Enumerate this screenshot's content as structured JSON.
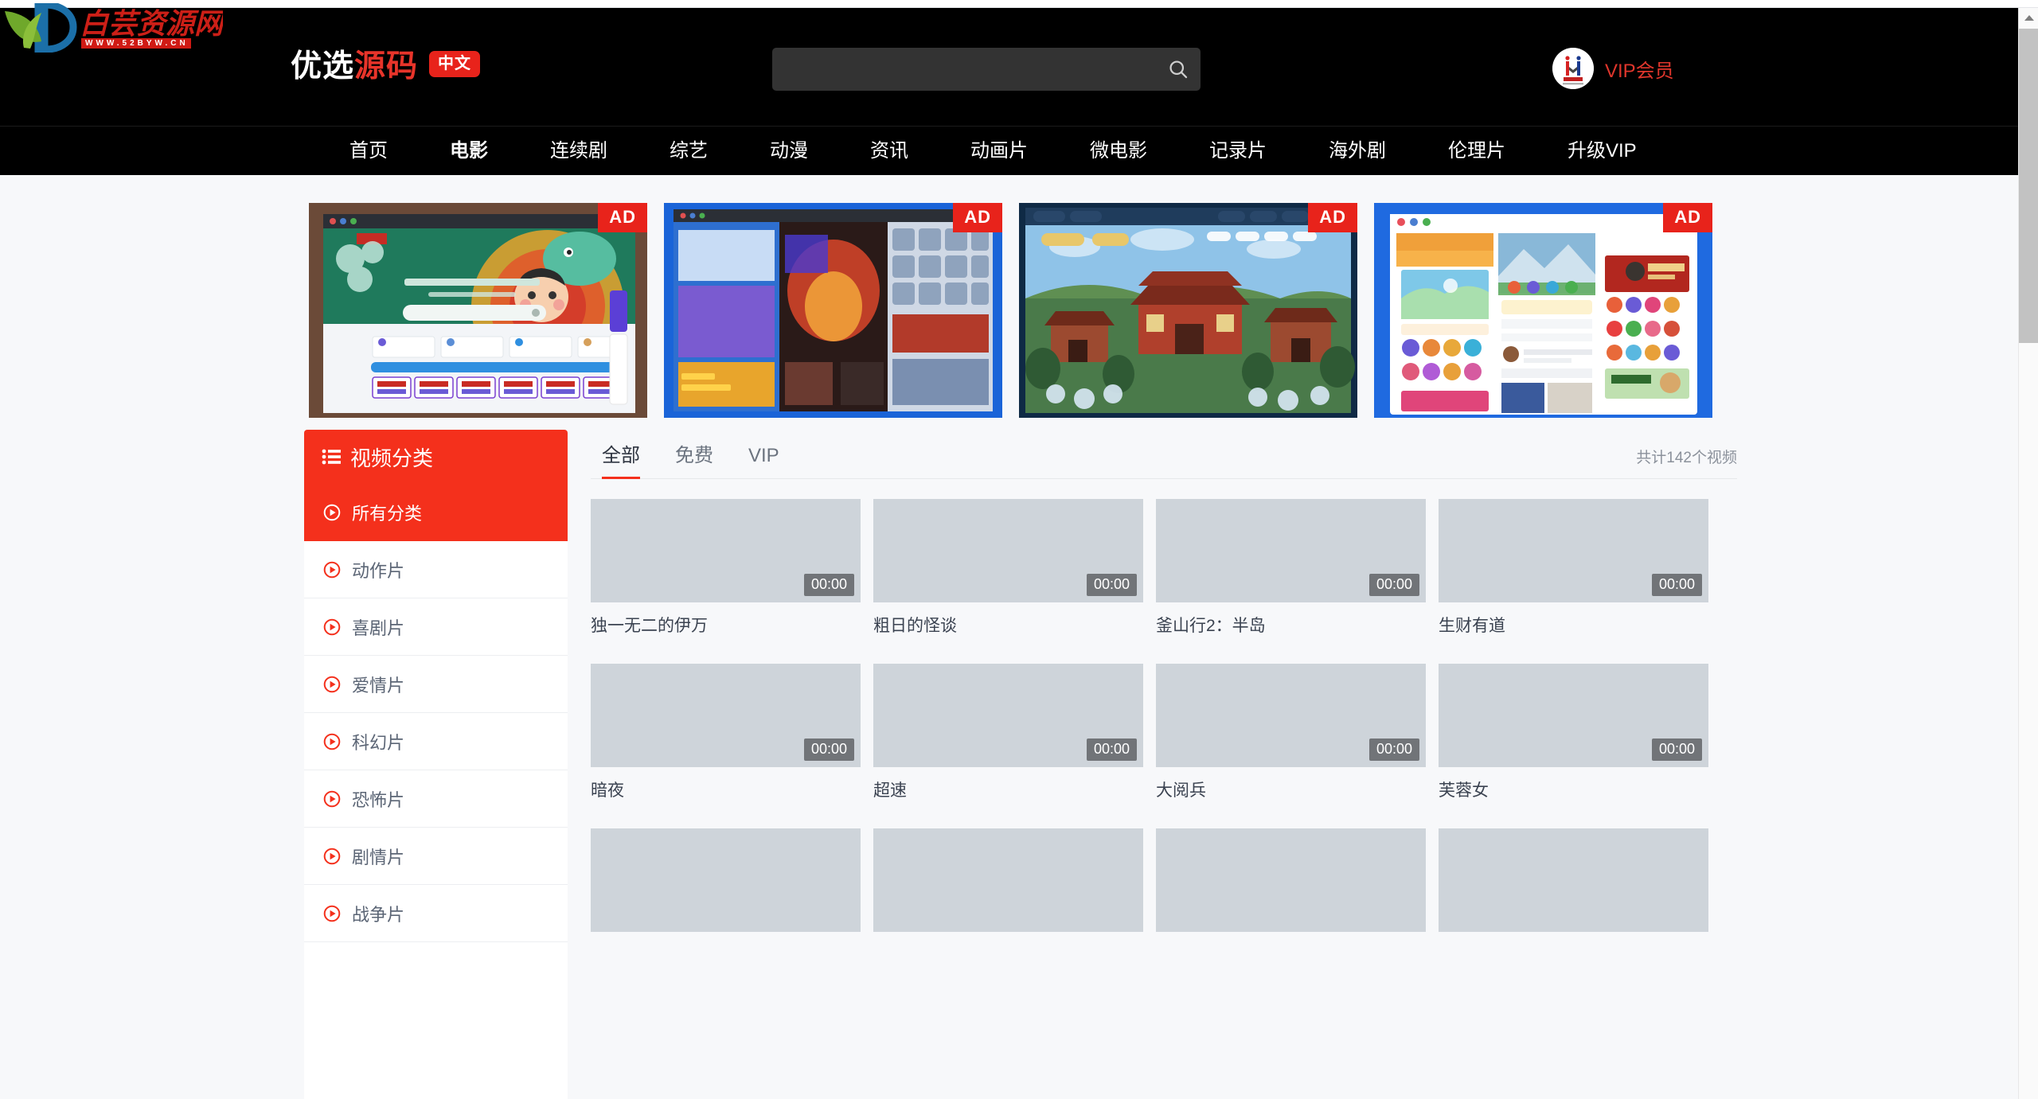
{
  "watermark": {
    "text_cn": "白芸资源网",
    "url": "WWW.52BYW.CN"
  },
  "header": {
    "brand_part1": "优选",
    "brand_part2": "源码",
    "brand_tag": "中文",
    "search": {
      "value": "",
      "placeholder": "",
      "icon": "search-icon"
    },
    "vip": {
      "label": "VIP会员",
      "avatar_icon": "user-avatar-icon"
    }
  },
  "nav": {
    "items": [
      {
        "label": "首页",
        "active": false
      },
      {
        "label": "电影",
        "active": true
      },
      {
        "label": "连续剧",
        "active": false
      },
      {
        "label": "综艺",
        "active": false
      },
      {
        "label": "动漫",
        "active": false
      },
      {
        "label": "资讯",
        "active": false
      },
      {
        "label": "动画片",
        "active": false
      },
      {
        "label": "微电影",
        "active": false
      },
      {
        "label": "记录片",
        "active": false
      },
      {
        "label": "海外剧",
        "active": false
      },
      {
        "label": "伦理片",
        "active": false
      },
      {
        "label": "升级VIP",
        "active": false
      }
    ]
  },
  "ads": {
    "badge_label": "AD",
    "items": [
      {
        "name": "ad-banner-1",
        "theme": "dragon-new-year-site"
      },
      {
        "name": "ad-banner-2",
        "theme": "anime-game-collage"
      },
      {
        "name": "ad-banner-3",
        "theme": "ancient-town-game"
      },
      {
        "name": "ad-banner-4",
        "theme": "mobile-app-screens"
      }
    ]
  },
  "sidebar": {
    "title": "视频分类",
    "title_icon": "list-icon",
    "items": [
      {
        "label": "所有分类",
        "icon": "play-circle-icon",
        "active": true
      },
      {
        "label": "动作片",
        "icon": "play-circle-icon",
        "active": false
      },
      {
        "label": "喜剧片",
        "icon": "play-circle-icon",
        "active": false
      },
      {
        "label": "爱情片",
        "icon": "play-circle-icon",
        "active": false
      },
      {
        "label": "科幻片",
        "icon": "play-circle-icon",
        "active": false
      },
      {
        "label": "恐怖片",
        "icon": "play-circle-icon",
        "active": false
      },
      {
        "label": "剧情片",
        "icon": "play-circle-icon",
        "active": false
      },
      {
        "label": "战争片",
        "icon": "play-circle-icon",
        "active": false
      }
    ]
  },
  "main": {
    "tabs": [
      {
        "label": "全部",
        "active": true
      },
      {
        "label": "免费",
        "active": false
      },
      {
        "label": "VIP",
        "active": false
      }
    ],
    "count_text": "共计142个视频",
    "videos": [
      {
        "title": "独一无二的伊万",
        "duration": "00:00"
      },
      {
        "title": "粗日的怪谈",
        "duration": "00:00"
      },
      {
        "title": "釜山行2：半岛",
        "duration": "00:00"
      },
      {
        "title": "生财有道",
        "duration": "00:00"
      },
      {
        "title": "暗夜",
        "duration": "00:00"
      },
      {
        "title": "超速",
        "duration": "00:00"
      },
      {
        "title": "大阅兵",
        "duration": "00:00"
      },
      {
        "title": "芙蓉女",
        "duration": "00:00"
      },
      {
        "title": "",
        "duration": ""
      },
      {
        "title": "",
        "duration": ""
      },
      {
        "title": "",
        "duration": ""
      },
      {
        "title": "",
        "duration": ""
      }
    ]
  },
  "colors": {
    "brand_red": "#f4301c",
    "header_black": "#000000",
    "page_bg": "#f7f8fa",
    "thumb_placeholder": "#ced4da",
    "search_bg": "#333333"
  },
  "scrollbar": {
    "up_arrow_icon": "chevron-up-icon"
  }
}
